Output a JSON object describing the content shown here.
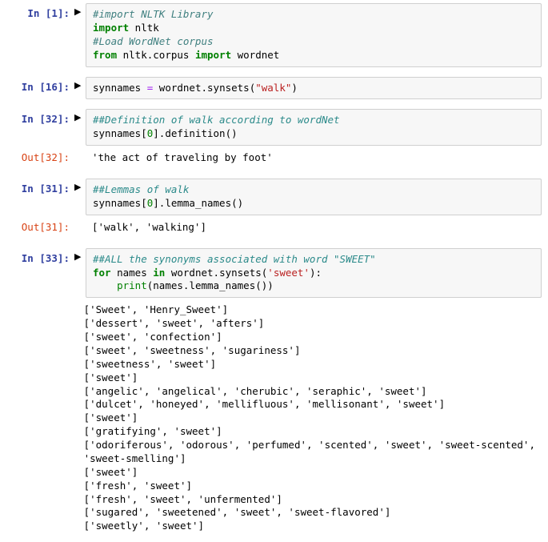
{
  "cells": [
    {
      "prompt_in": "In [1]:",
      "run_icon": "▶",
      "tokens": {
        "c1": "#import NLTK Library",
        "k1": "import",
        "n1": " nltk",
        "c2": "#Load WordNet corpus",
        "k2": "from",
        "n2": " nltk.corpus ",
        "k3": "import",
        "n3": " wordnet"
      }
    },
    {
      "prompt_in": "In [16]:",
      "run_icon": "▶",
      "tokens": {
        "l1a": "synnames ",
        "op1": "=",
        "l1b": " wordnet",
        "p1": ".",
        "l1c": "synsets(",
        "s1": "\"walk\"",
        "l1d": ")"
      }
    },
    {
      "prompt_in": "In [32]:",
      "run_icon": "▶",
      "tokens": {
        "c1": "##Definition of walk according to wordNet",
        "l2a": "synnames[",
        "num1": "0",
        "l2b": "]",
        "p1": ".",
        "l2c": "definition()"
      },
      "prompt_out": "Out[32]:",
      "output": "'the act of traveling by foot'"
    },
    {
      "prompt_in": "In [31]:",
      "run_icon": "▶",
      "tokens": {
        "c1": "##Lemmas of walk",
        "l2a": "synnames[",
        "num1": "0",
        "l2b": "]",
        "p1": ".",
        "l2c": "lemma_names()"
      },
      "prompt_out": "Out[31]:",
      "output": "['walk', 'walking']"
    },
    {
      "prompt_in": "In [33]:",
      "run_icon": "▶",
      "tokens": {
        "c1": "##ALL the synonyms associated with word \"SWEET\"",
        "k1": "for",
        "n1": " names ",
        "k2": "in",
        "n2": " wordnet",
        "p1": ".",
        "n3": "synsets(",
        "s1": "'sweet'",
        "n4": "):",
        "indent": "    ",
        "fn1": "print",
        "n5": "(names",
        "p2": ".",
        "n6": "lemma_names())"
      },
      "stream_output": "['Sweet', 'Henry_Sweet']\n['dessert', 'sweet', 'afters']\n['sweet', 'confection']\n['sweet', 'sweetness', 'sugariness']\n['sweetness', 'sweet']\n['sweet']\n['angelic', 'angelical', 'cherubic', 'seraphic', 'sweet']\n['dulcet', 'honeyed', 'mellifluous', 'mellisonant', 'sweet']\n['sweet']\n['gratifying', 'sweet']\n['odoriferous', 'odorous', 'perfumed', 'scented', 'sweet', 'sweet-scented',\n'sweet-smelling']\n['sweet']\n['fresh', 'sweet']\n['fresh', 'sweet', 'unfermented']\n['sugared', 'sweetened', 'sweet', 'sweet-flavored']\n['sweetly', 'sweet']"
    }
  ],
  "chart_data": null
}
